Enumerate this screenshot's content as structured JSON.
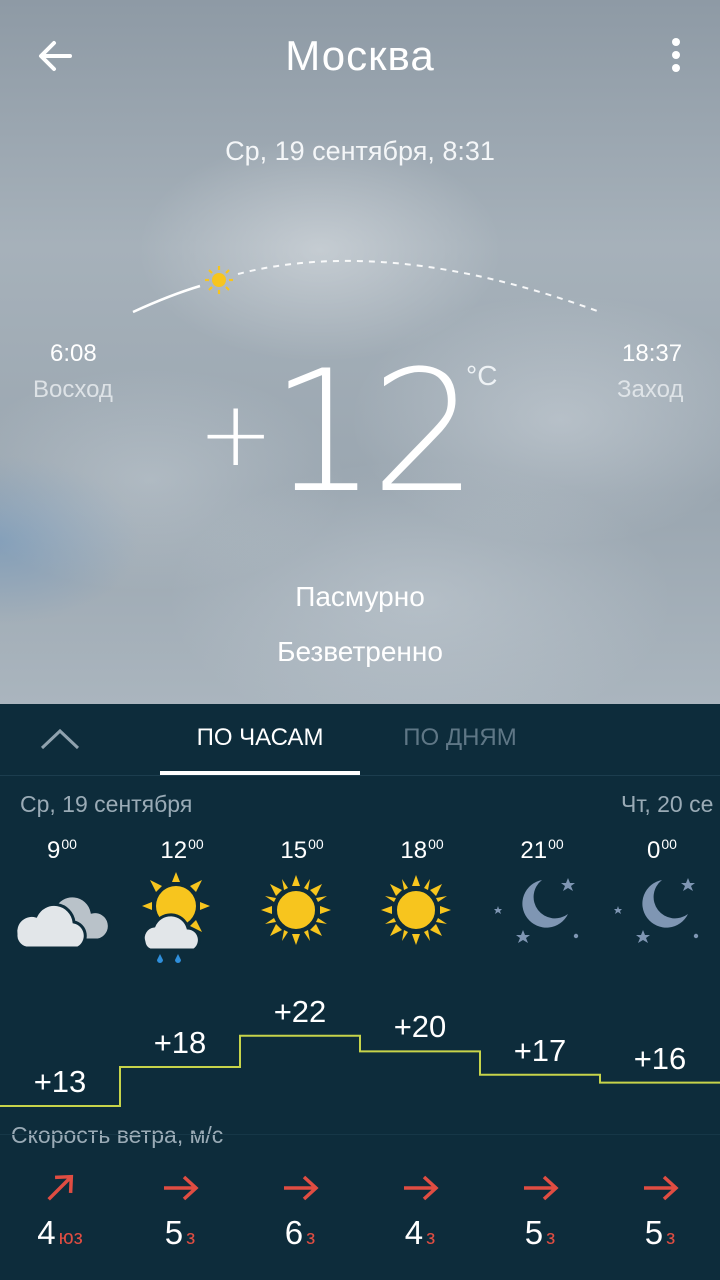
{
  "header": {
    "city": "Москва",
    "datetime": "Ср, 19 сентября, 8:31"
  },
  "sun": {
    "sunrise_time": "6:08",
    "sunrise_label": "Восход",
    "sunset_time": "18:37",
    "sunset_label": "Заход"
  },
  "current": {
    "temp_sign": "+",
    "temp_value": "12",
    "unit": "°C",
    "condition": "Пасмурно",
    "wind": "Безветренно"
  },
  "tabs": {
    "hourly": "ПО ЧАСАМ",
    "daily": "ПО ДНЯМ"
  },
  "days": {
    "today": "Ср, 19 сентября",
    "next": "Чт, 20 се"
  },
  "hourly": [
    {
      "hour": "9",
      "min": "00",
      "icon": "cloudy-icon",
      "temp": "+13",
      "wind_speed": "4",
      "wind_dir": "юз"
    },
    {
      "hour": "12",
      "min": "00",
      "icon": "partly-cloudy-rain-icon",
      "temp": "+18",
      "wind_speed": "5",
      "wind_dir": "з"
    },
    {
      "hour": "15",
      "min": "00",
      "icon": "sun-icon",
      "temp": "+22",
      "wind_speed": "6",
      "wind_dir": "з"
    },
    {
      "hour": "18",
      "min": "00",
      "icon": "sun-icon",
      "temp": "+20",
      "wind_speed": "4",
      "wind_dir": "з"
    },
    {
      "hour": "21",
      "min": "00",
      "icon": "moon-stars-icon",
      "temp": "+17",
      "wind_speed": "5",
      "wind_dir": "з"
    },
    {
      "hour": "0",
      "min": "00",
      "icon": "moon-stars-icon",
      "temp": "+16",
      "wind_speed": "5",
      "wind_dir": "з"
    }
  ],
  "wind_section": {
    "title": "Скорость ветра, м/с"
  },
  "colors": {
    "panel": "#0d2c3b",
    "temp_line": "#c7d44a",
    "wind_arrow": "#e04d42",
    "sun": "#f7c51e",
    "moon": "#7f96b3"
  }
}
